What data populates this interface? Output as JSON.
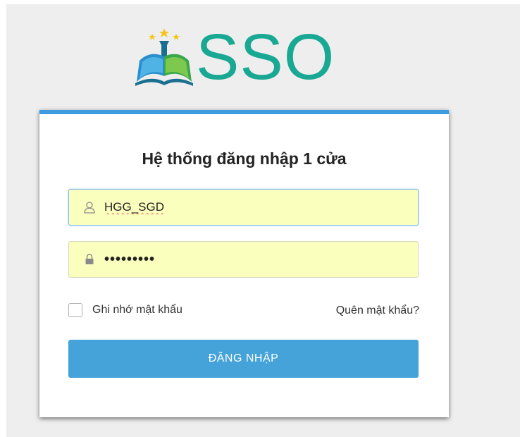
{
  "logo": {
    "text": "SSO"
  },
  "login": {
    "title": "Hệ thống đăng nhập 1 cửa",
    "username_value": "HGG_SGD",
    "password_value": "•••••••••",
    "remember_label": "Ghi nhớ mật khẩu",
    "remember_checked": false,
    "forgot_label": "Quên mật khẩu?",
    "submit_label": "ĐĂNG NHẬP"
  },
  "colors": {
    "accent": "#3c9be1",
    "button": "#45a3d9",
    "logo": "#19a893",
    "autofill_bg": "#faffbd"
  },
  "icons": {
    "logo_emblem": "book-with-stars-icon",
    "username": "user-icon",
    "password": "lock-icon"
  }
}
